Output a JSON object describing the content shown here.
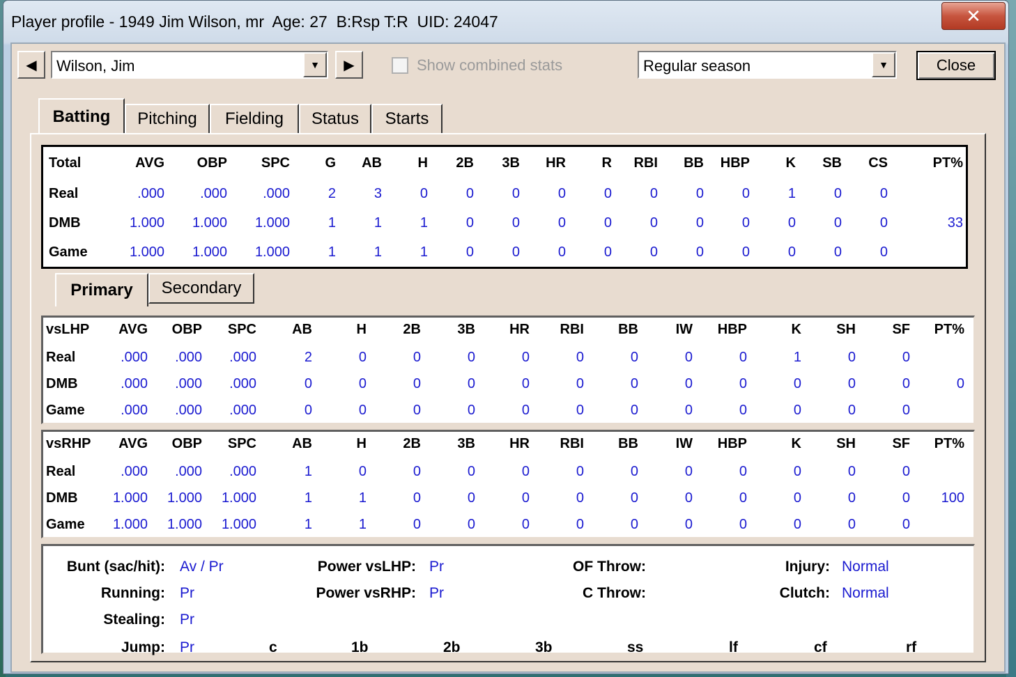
{
  "window": {
    "title": "Player profile - 1949 Jim Wilson, mr  Age: 27  B:Rsp T:R  UID: 24047",
    "close_glyph": "✕"
  },
  "toolbar": {
    "prev_glyph": "◀",
    "next_glyph": "▶",
    "player_select": "Wilson, Jim",
    "combined_label": "Show combined stats",
    "combined_checked": false,
    "season_select": "Regular season",
    "close_label": "Close",
    "dropdown_glyph": "▼"
  },
  "tabs": [
    {
      "label": "Batting",
      "active": true
    },
    {
      "label": "Pitching",
      "active": false
    },
    {
      "label": "Fielding",
      "active": false
    },
    {
      "label": "Status",
      "active": false
    },
    {
      "label": "Starts",
      "active": false
    }
  ],
  "total_table": {
    "headers": [
      "Total",
      "AVG",
      "OBP",
      "SPC",
      "G",
      "AB",
      "H",
      "2B",
      "3B",
      "HR",
      "R",
      "RBI",
      "BB",
      "HBP",
      "K",
      "SB",
      "CS",
      "PT%"
    ],
    "rows": [
      {
        "label": "Real",
        "values": [
          ".000",
          ".000",
          ".000",
          "2",
          "3",
          "0",
          "0",
          "0",
          "0",
          "0",
          "0",
          "0",
          "0",
          "1",
          "0",
          "0",
          ""
        ]
      },
      {
        "label": "DMB",
        "values": [
          "1.000",
          "1.000",
          "1.000",
          "1",
          "1",
          "1",
          "0",
          "0",
          "0",
          "0",
          "0",
          "0",
          "0",
          "0",
          "0",
          "0",
          "33"
        ]
      },
      {
        "label": "Game",
        "values": [
          "1.000",
          "1.000",
          "1.000",
          "1",
          "1",
          "1",
          "0",
          "0",
          "0",
          "0",
          "0",
          "0",
          "0",
          "0",
          "0",
          "0",
          ""
        ]
      }
    ]
  },
  "subtabs": [
    {
      "label": "Primary",
      "active": true
    },
    {
      "label": "Secondary",
      "active": false
    }
  ],
  "split_tables": [
    {
      "headers": [
        "vsLHP",
        "AVG",
        "OBP",
        "SPC",
        "AB",
        "H",
        "2B",
        "3B",
        "HR",
        "RBI",
        "BB",
        "IW",
        "HBP",
        "K",
        "SH",
        "SF",
        "PT%"
      ],
      "rows": [
        {
          "label": "Real",
          "values": [
            ".000",
            ".000",
            ".000",
            "2",
            "0",
            "0",
            "0",
            "0",
            "0",
            "0",
            "0",
            "0",
            "1",
            "0",
            "0",
            ""
          ]
        },
        {
          "label": "DMB",
          "values": [
            ".000",
            ".000",
            ".000",
            "0",
            "0",
            "0",
            "0",
            "0",
            "0",
            "0",
            "0",
            "0",
            "0",
            "0",
            "0",
            "0"
          ]
        },
        {
          "label": "Game",
          "values": [
            ".000",
            ".000",
            ".000",
            "0",
            "0",
            "0",
            "0",
            "0",
            "0",
            "0",
            "0",
            "0",
            "0",
            "0",
            "0",
            ""
          ]
        }
      ]
    },
    {
      "headers": [
        "vsRHP",
        "AVG",
        "OBP",
        "SPC",
        "AB",
        "H",
        "2B",
        "3B",
        "HR",
        "RBI",
        "BB",
        "IW",
        "HBP",
        "K",
        "SH",
        "SF",
        "PT%"
      ],
      "rows": [
        {
          "label": "Real",
          "values": [
            ".000",
            ".000",
            ".000",
            "1",
            "0",
            "0",
            "0",
            "0",
            "0",
            "0",
            "0",
            "0",
            "0",
            "0",
            "0",
            ""
          ]
        },
        {
          "label": "DMB",
          "values": [
            "1.000",
            "1.000",
            "1.000",
            "1",
            "1",
            "0",
            "0",
            "0",
            "0",
            "0",
            "0",
            "0",
            "0",
            "0",
            "0",
            "100"
          ]
        },
        {
          "label": "Game",
          "values": [
            "1.000",
            "1.000",
            "1.000",
            "1",
            "1",
            "0",
            "0",
            "0",
            "0",
            "0",
            "0",
            "0",
            "0",
            "0",
            "0",
            ""
          ]
        }
      ]
    }
  ],
  "attributes": {
    "bunt_label": "Bunt (sac/hit):",
    "bunt_value": "Av / Pr",
    "running_label": "Running:",
    "running_value": "Pr",
    "stealing_label": "Stealing:",
    "stealing_value": "Pr",
    "jump_label": "Jump:",
    "jump_value": "Pr",
    "power_lhp_label": "Power vsLHP:",
    "power_lhp_value": "Pr",
    "power_rhp_label": "Power vsRHP:",
    "power_rhp_value": "Pr",
    "of_throw_label": "OF Throw:",
    "of_throw_value": "",
    "c_throw_label": "C Throw:",
    "c_throw_value": "",
    "injury_label": "Injury:",
    "injury_value": "Normal",
    "clutch_label": "Clutch:",
    "clutch_value": "Normal",
    "positions": [
      "c",
      "1b",
      "2b",
      "3b",
      "ss",
      "lf",
      "cf",
      "rf"
    ]
  }
}
